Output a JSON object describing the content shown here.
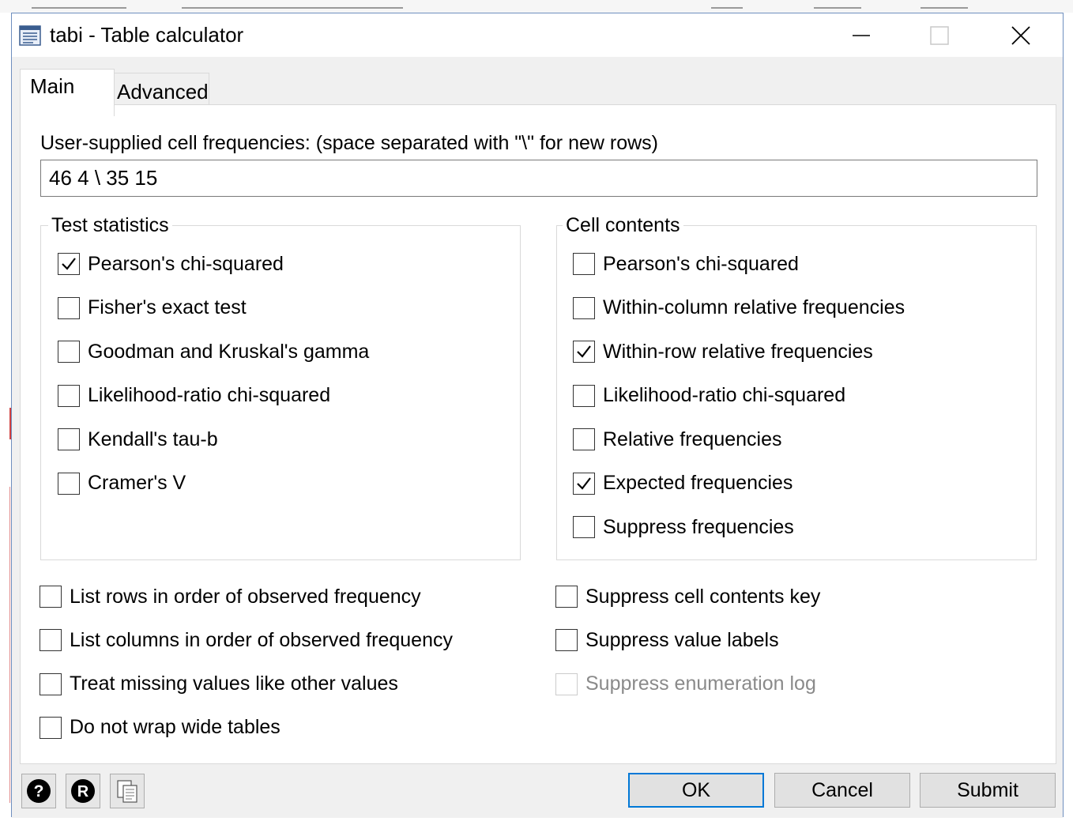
{
  "window": {
    "title": "tabi - Table calculator"
  },
  "tabs": [
    {
      "label": "Main",
      "active": true
    },
    {
      "label": "Advanced",
      "active": false
    }
  ],
  "frequencies": {
    "label": "User-supplied cell frequencies:  (space separated with \"\\\" for new rows)",
    "value": "46 4 \\ 35 15"
  },
  "test_statistics": {
    "title": "Test statistics",
    "options": [
      {
        "label": "Pearson's chi-squared",
        "checked": true
      },
      {
        "label": "Fisher's exact test",
        "checked": false
      },
      {
        "label": "Goodman and Kruskal's gamma",
        "checked": false
      },
      {
        "label": "Likelihood-ratio chi-squared",
        "checked": false
      },
      {
        "label": "Kendall's tau-b",
        "checked": false
      },
      {
        "label": "Cramer's V",
        "checked": false
      }
    ]
  },
  "cell_contents": {
    "title": "Cell contents",
    "options": [
      {
        "label": "Pearson's chi-squared",
        "checked": false
      },
      {
        "label": "Within-column relative frequencies",
        "checked": false
      },
      {
        "label": "Within-row relative frequencies",
        "checked": true
      },
      {
        "label": "Likelihood-ratio chi-squared",
        "checked": false
      },
      {
        "label": "Relative frequencies",
        "checked": false
      },
      {
        "label": "Expected frequencies",
        "checked": true
      },
      {
        "label": "Suppress frequencies",
        "checked": false
      }
    ]
  },
  "bottom_left": [
    {
      "label": "List rows in order of observed frequency",
      "checked": false
    },
    {
      "label": "List columns in order of observed frequency",
      "checked": false
    },
    {
      "label": "Treat missing values like other values",
      "checked": false
    },
    {
      "label": "Do not wrap wide tables",
      "checked": false
    }
  ],
  "bottom_right": [
    {
      "label": "Suppress cell contents key",
      "checked": false,
      "disabled": false
    },
    {
      "label": "Suppress value labels",
      "checked": false,
      "disabled": false
    },
    {
      "label": "Suppress enumeration log",
      "checked": false,
      "disabled": true
    }
  ],
  "buttons": {
    "ok": "OK",
    "cancel": "Cancel",
    "submit": "Submit"
  },
  "icons": [
    "help-icon",
    "reset-icon",
    "copy-icon"
  ]
}
